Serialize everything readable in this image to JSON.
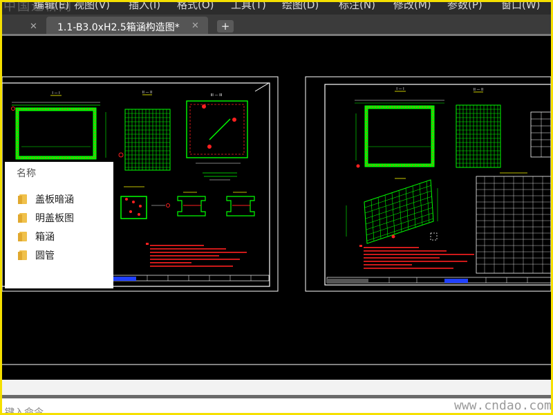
{
  "app": {
    "watermark": "中国道桥网",
    "site_watermark": "www.cndao.com"
  },
  "menubar": {
    "items": [
      {
        "label": "编辑(E)"
      },
      {
        "label": "视图(V)"
      },
      {
        "label": "插入(I)"
      },
      {
        "label": "格式(O)"
      },
      {
        "label": "工具(T)"
      },
      {
        "label": "绘图(D)"
      },
      {
        "label": "标注(N)"
      },
      {
        "label": "修改(M)"
      },
      {
        "label": "参数(P)"
      },
      {
        "label": "窗口(W)"
      }
    ]
  },
  "tabs": {
    "active_title": "1.1-B3.0xH2.5箱涵构造图*",
    "close_glyph": "✕",
    "add_glyph": "+"
  },
  "file_panel": {
    "header": "名称",
    "items": [
      {
        "label": "盖板暗涵"
      },
      {
        "label": "明盖板图"
      },
      {
        "label": "箱涵"
      },
      {
        "label": "圆管"
      }
    ]
  },
  "command": {
    "prompt": "键入命令"
  },
  "colors": {
    "frame": "#f5e000",
    "drawing_green": "#00ff00",
    "drawing_red": "#ff2020",
    "drawing_white": "#ffffff",
    "drawing_yellow": "#ffff00",
    "drawing_blue": "#2040ff"
  }
}
